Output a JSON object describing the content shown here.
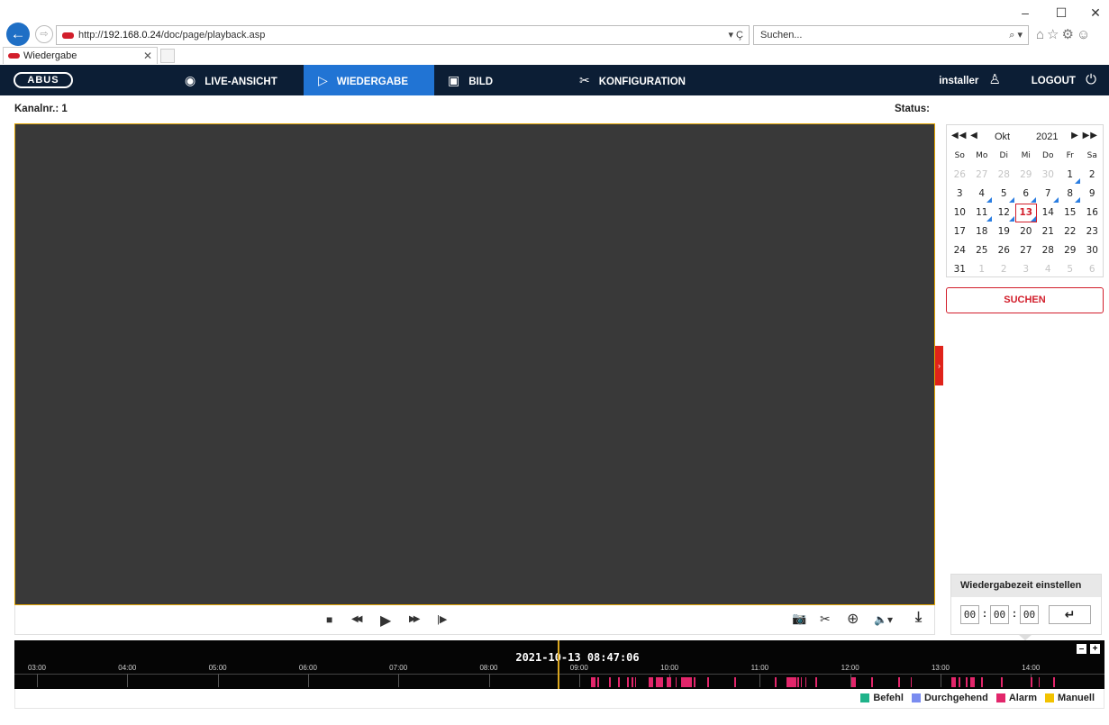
{
  "browser": {
    "window_controls": [
      "–",
      "☐",
      "✕"
    ],
    "url_scheme_host": "http://",
    "url_host": "192.168.0.24",
    "url_path": "/doc/page/playback.asp",
    "url_tools": "▾ Ç",
    "search_placeholder": "Suchen...",
    "search_tools": "⌕ ▾",
    "toolbar_icons": "⌂☆⚙☺",
    "tab_title": "Wiedergabe",
    "tab_close": "✕"
  },
  "nav": {
    "logo": "ABUS",
    "items": [
      {
        "label": "LIVE-ANSICHT",
        "icon": "eye-icon",
        "glyph": "◉"
      },
      {
        "label": "WIEDERGABE",
        "icon": "play-icon",
        "glyph": "▷"
      },
      {
        "label": "BILD",
        "icon": "image-icon",
        "glyph": "▣"
      },
      {
        "label": "KONFIGURATION",
        "icon": "tools-icon",
        "glyph": "✂"
      }
    ],
    "user": "installer",
    "user_glyph": "♙",
    "logout": "LOGOUT",
    "logout_glyph": "⏻",
    "active_color": "#2174d4"
  },
  "main": {
    "channel_label": "Kanalnr.: 1",
    "status_label": "Status:",
    "side_tab_glyph": "›"
  },
  "controls": {
    "stop": "■",
    "rewind": "◀◀",
    "play": "▶",
    "fast_forward": "▶▶",
    "step": "|▶",
    "snapshot": "📷",
    "clip": "✂",
    "zoom": "⊕",
    "audio": "🔈▾",
    "download": "⤓"
  },
  "calendar": {
    "prev": "◀◀ ◀",
    "month": "Okt",
    "year": "2021",
    "next": "▶ ▶▶",
    "weekdays": [
      "So",
      "Mo",
      "Di",
      "Mi",
      "Do",
      "Fr",
      "Sa"
    ],
    "weeks": [
      [
        "26",
        "27",
        "28",
        "29",
        "30",
        "1",
        "2"
      ],
      [
        "3",
        "4",
        "5",
        "6",
        "7",
        "8",
        "9"
      ],
      [
        "10",
        "11",
        "12",
        "13",
        "14",
        "15",
        "16"
      ],
      [
        "17",
        "18",
        "19",
        "20",
        "21",
        "22",
        "23"
      ],
      [
        "24",
        "25",
        "26",
        "27",
        "28",
        "29",
        "30"
      ],
      [
        "31",
        "1",
        "2",
        "3",
        "4",
        "5",
        "6"
      ]
    ],
    "selected_day": "13",
    "days_with_recordings": [
      "1",
      "4",
      "5",
      "6",
      "7",
      "8",
      "11",
      "12",
      "13"
    ],
    "search_label": "SUCHEN"
  },
  "playback_time": {
    "title": "Wiedergabezeit einstellen",
    "hours": "00",
    "minutes": "00",
    "seconds": "00",
    "separator": ":",
    "enter_glyph": "↵"
  },
  "timeline": {
    "current_time": "2021-10-13 08:47:06",
    "hours": [
      "03:00",
      "04:00",
      "05:00",
      "06:00",
      "07:00",
      "08:00",
      "09:00",
      "10:00",
      "11:00",
      "12:00",
      "13:00",
      "14:00"
    ],
    "zoom_out": "–",
    "zoom_in": "+",
    "recordings": [
      {
        "start": "09:08",
        "end": "09:11"
      },
      {
        "start": "09:12",
        "end": "09:13"
      },
      {
        "start": "09:20",
        "end": "09:21"
      },
      {
        "start": "09:26",
        "end": "09:27"
      },
      {
        "start": "09:32",
        "end": "09:33"
      },
      {
        "start": "09:35",
        "end": "09:36"
      },
      {
        "start": "09:37",
        "end": "09:38"
      },
      {
        "start": "09:46",
        "end": "09:49"
      },
      {
        "start": "09:51",
        "end": "09:56"
      },
      {
        "start": "09:58",
        "end": "10:01"
      },
      {
        "start": "10:04",
        "end": "10:05"
      },
      {
        "start": "10:08",
        "end": "10:15"
      },
      {
        "start": "10:16",
        "end": "10:17"
      },
      {
        "start": "10:25",
        "end": "10:26"
      },
      {
        "start": "10:43",
        "end": "10:44"
      },
      {
        "start": "11:10",
        "end": "11:11"
      },
      {
        "start": "11:18",
        "end": "11:24"
      },
      {
        "start": "11:25",
        "end": "11:26"
      },
      {
        "start": "11:27",
        "end": "11:28"
      },
      {
        "start": "11:30",
        "end": "11:31"
      },
      {
        "start": "11:37",
        "end": "11:38"
      },
      {
        "start": "12:01",
        "end": "12:04"
      },
      {
        "start": "12:14",
        "end": "12:15"
      },
      {
        "start": "12:32",
        "end": "12:33"
      },
      {
        "start": "12:40",
        "end": "12:41"
      },
      {
        "start": "13:07",
        "end": "13:10"
      },
      {
        "start": "13:12",
        "end": "13:13"
      },
      {
        "start": "13:17",
        "end": "13:18"
      },
      {
        "start": "13:20",
        "end": "13:23"
      },
      {
        "start": "13:27",
        "end": "13:28"
      },
      {
        "start": "13:40",
        "end": "13:41"
      },
      {
        "start": "14:00",
        "end": "14:01"
      },
      {
        "start": "14:05",
        "end": "14:06"
      },
      {
        "start": "14:15",
        "end": "14:16"
      }
    ]
  },
  "legend": [
    {
      "label": "Befehl",
      "color": "#1fb38a"
    },
    {
      "label": "Durchgehend",
      "color": "#7a8cf0"
    },
    {
      "label": "Alarm",
      "color": "#e2266b"
    },
    {
      "label": "Manuell",
      "color": "#f2c200"
    }
  ],
  "colors": {
    "brand_red": "#d21e2b",
    "nav_bg": "#0c1e35",
    "video_border": "#e2a400",
    "cursor": "#d9a51f"
  }
}
